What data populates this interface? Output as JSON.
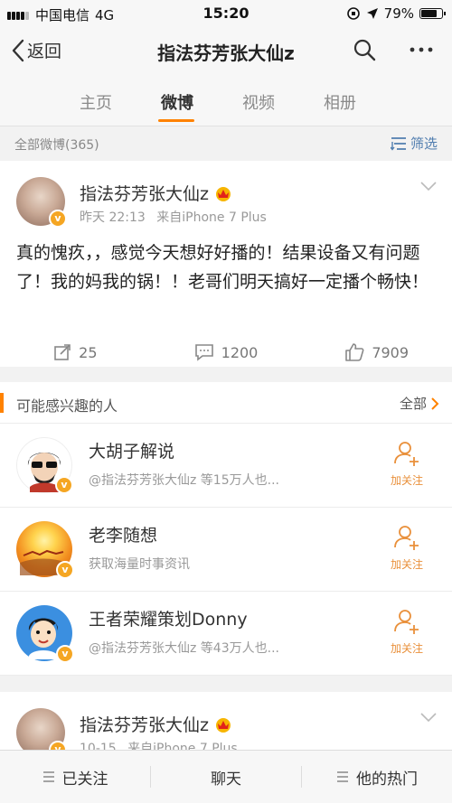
{
  "status_bar": {
    "carrier": "中国电信",
    "network": "4G",
    "time": "15:20",
    "battery": "79%",
    "battery_level": 0.79
  },
  "nav": {
    "back_label": "返回",
    "title": "指法芬芳张大仙z",
    "icons": [
      "search-icon",
      "more-icon"
    ]
  },
  "tabs": [
    {
      "label": "主页",
      "active": false
    },
    {
      "label": "微博",
      "active": true
    },
    {
      "label": "视频",
      "active": false
    },
    {
      "label": "相册",
      "active": false
    }
  ],
  "filter": {
    "count_label": "全部微博(365)",
    "filter_label": "筛选"
  },
  "posts": [
    {
      "author": "指法芬芳张大仙z",
      "time": "昨天 22:13",
      "source": "来自iPhone 7 Plus",
      "text": "真的愧疚，，感觉今天想好好播的！结果设备又有问题了！我的妈我的锅！！老哥们明天搞好一定播个畅快！",
      "reposts": "25",
      "comments": "1200",
      "likes": "7909"
    },
    {
      "author": "指法芬芳张大仙z",
      "time": "10-15",
      "source": "来自iPhone 7 Plus"
    }
  ],
  "recommend": {
    "title": "可能感兴趣的人",
    "all_label": "全部",
    "people": [
      {
        "name": "大胡子解说",
        "desc": "@指法芬芳张大仙z 等15万人也...",
        "follow_label": "加关注"
      },
      {
        "name": "老李随想",
        "desc": "获取海量时事资讯",
        "follow_label": "加关注"
      },
      {
        "name": "王者荣耀策划Donny",
        "desc": "@指法芬芳张大仙z 等43万人也...",
        "follow_label": "加关注"
      }
    ]
  },
  "bottom_bar": {
    "followed_label": "已关注",
    "chat_label": "聊天",
    "hot_label": "他的热门"
  },
  "colors": {
    "accent": "#ff8200",
    "link": "#507daf",
    "follow": "#e9903b",
    "verified": "#f5a623"
  }
}
